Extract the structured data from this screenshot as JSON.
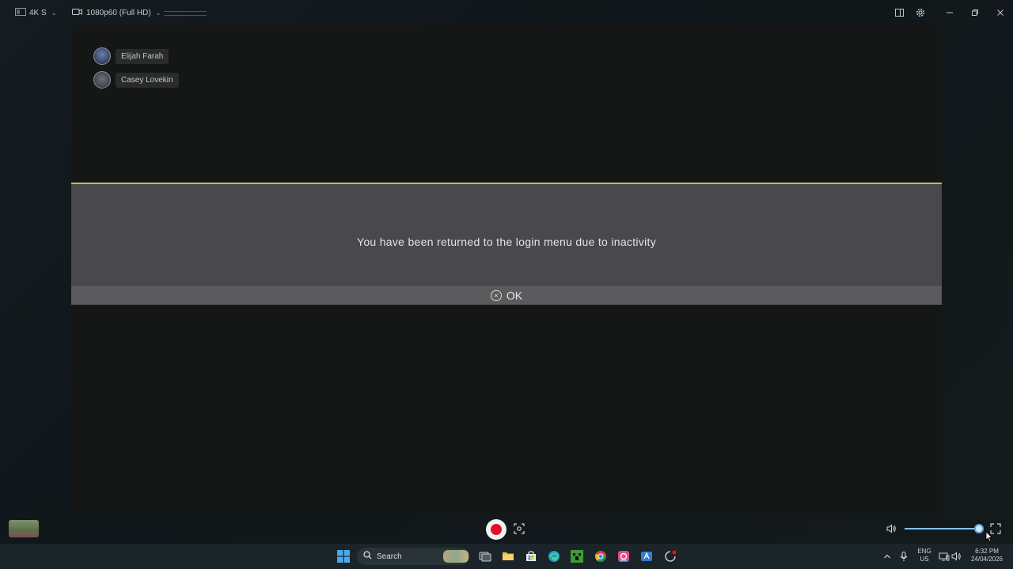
{
  "topbar": {
    "quality_label": "4K S",
    "resolution_label": "1080p60 (Full HD)"
  },
  "users": [
    {
      "name": "Elijah Farah"
    },
    {
      "name": "Casey Lovekin"
    }
  ],
  "dialog": {
    "message": "You have been returned to the login menu due to inactivity",
    "ok_label": "OK"
  },
  "controls": {
    "volume_level": 0.96
  },
  "taskbar": {
    "search_label": "Search",
    "language": "ENG",
    "region": "US",
    "time": "6:32 PM",
    "date": "24/04/2026"
  },
  "colors": {
    "accent_line": "#c8b94a",
    "record": "#e0102a",
    "volume": "#7cc4ee"
  }
}
